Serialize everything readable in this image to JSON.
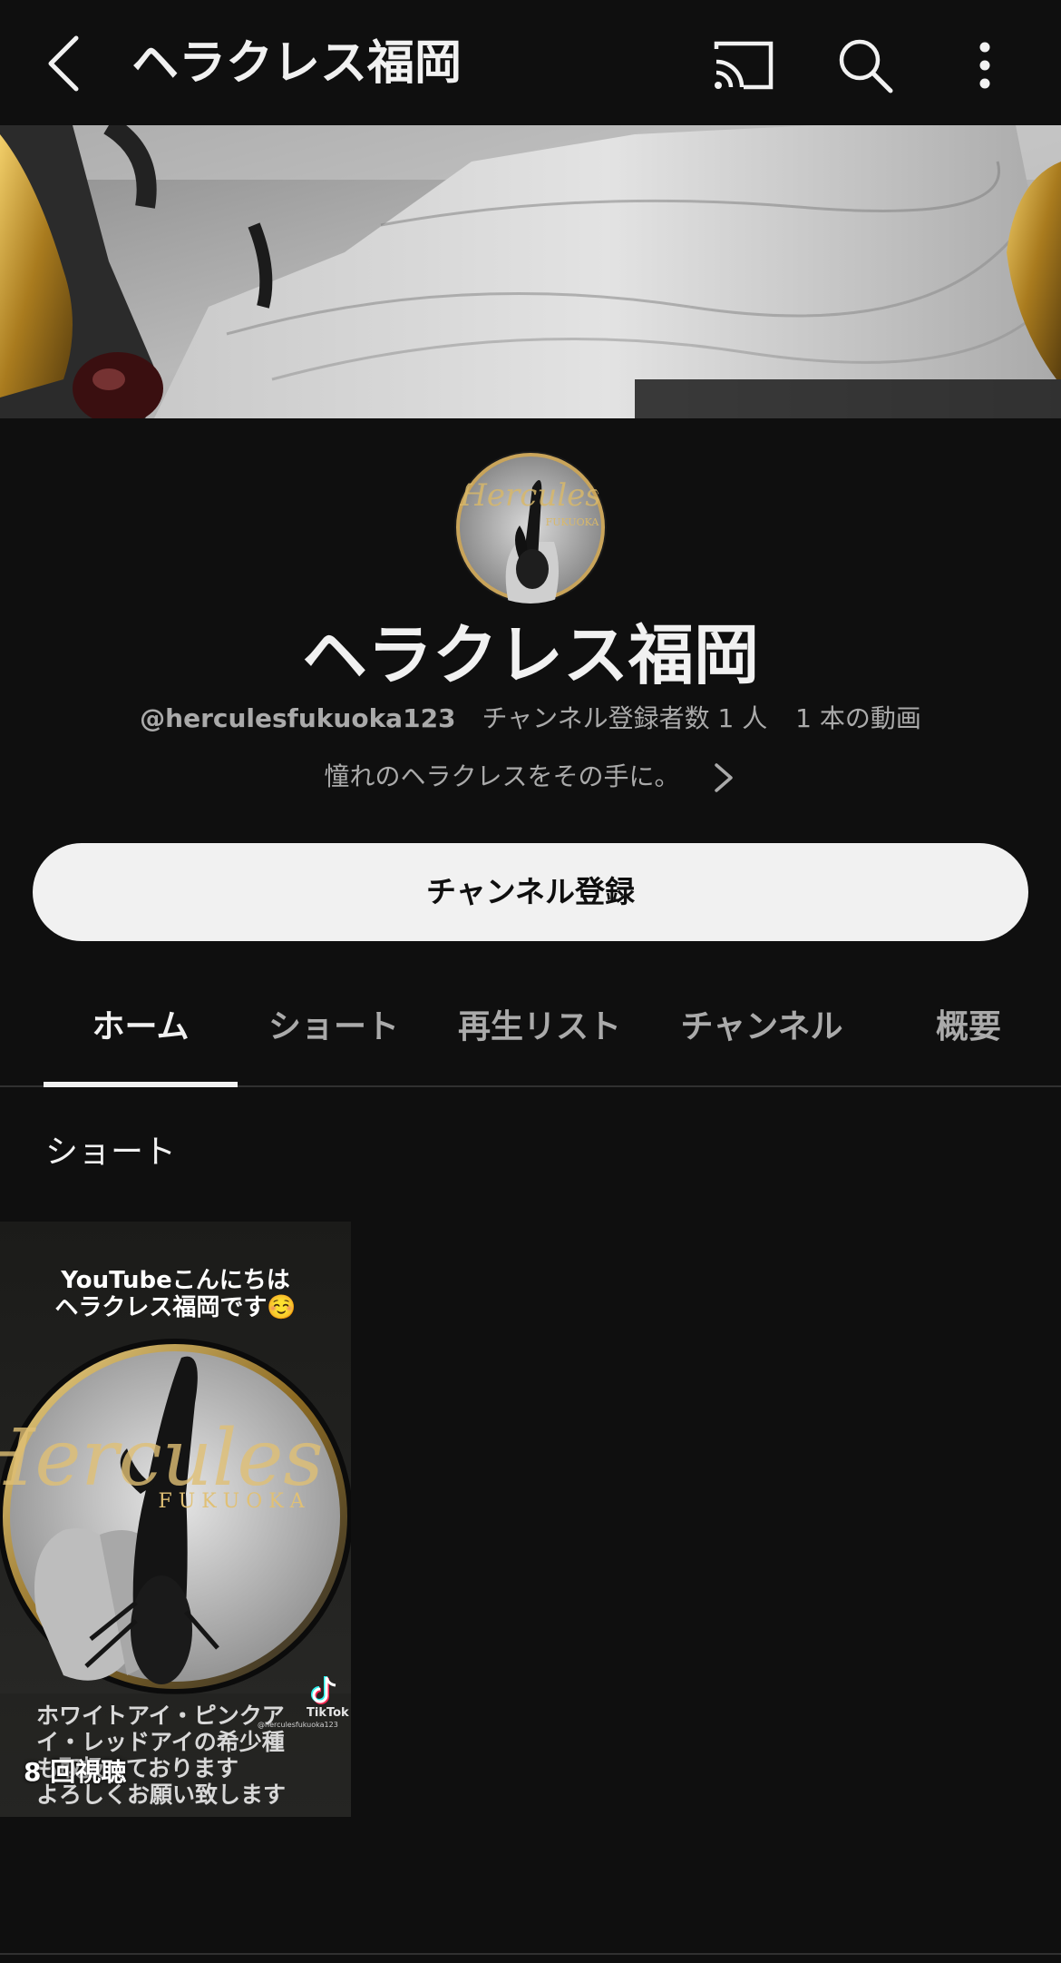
{
  "app_bar": {
    "title": "ヘラクレス福岡",
    "icons": [
      "back-arrow-icon",
      "cast-icon",
      "search-icon",
      "more-vertical-icon"
    ]
  },
  "channel": {
    "name": "ヘラクレス福岡",
    "handle": "@herculesfukuoka123",
    "subscribers": "チャンネル登録者数 1 人",
    "video_count": "1 本の動画",
    "description": "憧れのヘラクレスをその手に。",
    "avatar_text": "Hercules",
    "avatar_subtext": "FUKUOKA"
  },
  "subscribe_button": {
    "label": "チャンネル登録"
  },
  "tabs": [
    {
      "label": "ホーム",
      "active": true
    },
    {
      "label": "ショート",
      "active": false
    },
    {
      "label": "再生リスト",
      "active": false
    },
    {
      "label": "チャンネル",
      "active": false
    },
    {
      "label": "概要",
      "active": false
    }
  ],
  "section": {
    "title": "ショート"
  },
  "shorts": [
    {
      "caption_top": "YouTubeこんにちは\nヘラクレス福岡です☺️",
      "logo_text": "Hercules",
      "logo_subtext": "F U K U O K A",
      "caption_bottom": "ホワイトアイ・ピンクア\nイ・レッドアイの希少種\nも取扱っております\nよろしくお願い致します",
      "views": "8 回視聴",
      "watermark": "TikTok",
      "watermark_handle": "@herculesfukuoka123"
    }
  ],
  "colors": {
    "background": "#0f0f0f",
    "text_primary": "#f1f1f1",
    "text_secondary": "#aaaaaa",
    "subscribe_bg": "#f1f1f1",
    "gold": "#c9a45a"
  }
}
